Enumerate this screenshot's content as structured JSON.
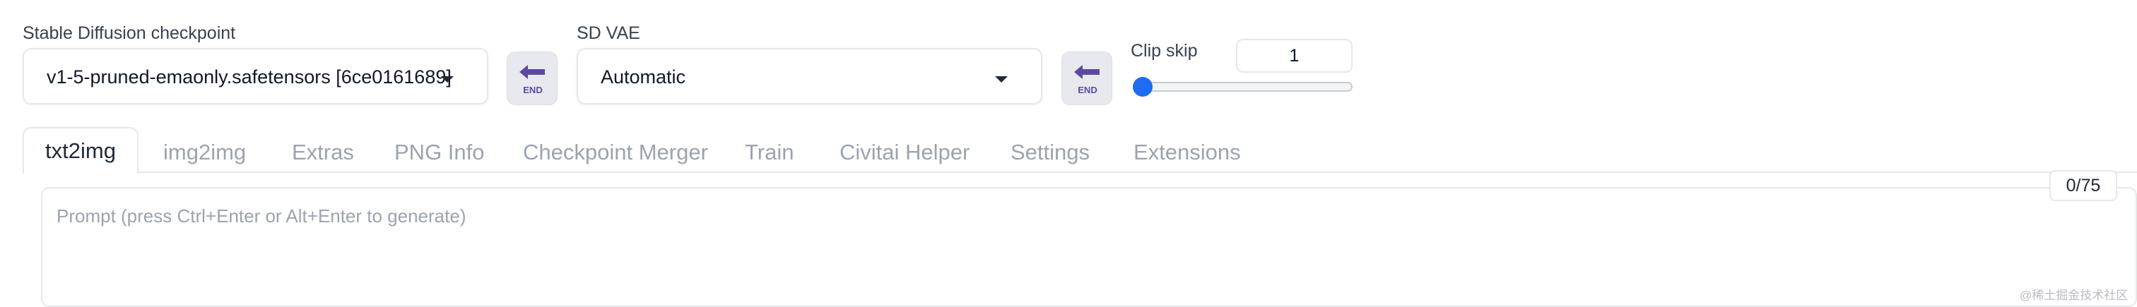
{
  "checkpoint": {
    "label": "Stable Diffusion checkpoint",
    "value": "v1-5-pruned-emaonly.safetensors [6ce0161689]"
  },
  "vae": {
    "label": "SD VAE",
    "value": "Automatic"
  },
  "refresh_icon": "refresh-end-icon",
  "clip_skip": {
    "label": "Clip skip",
    "value": "1",
    "slider_level": 0
  },
  "tabs": [
    {
      "label": "txt2img",
      "active": true
    },
    {
      "label": "img2img"
    },
    {
      "label": "Extras"
    },
    {
      "label": "PNG Info"
    },
    {
      "label": "Checkpoint Merger"
    },
    {
      "label": "Train"
    },
    {
      "label": "Civitai Helper"
    },
    {
      "label": "Settings"
    },
    {
      "label": "Extensions"
    }
  ],
  "prompt": {
    "placeholder": "Prompt (press Ctrl+Enter or Alt+Enter to generate)",
    "token_counter": "0/75"
  },
  "watermark": "@稀土掘金技术社区",
  "colors": {
    "accent": "#1d6cf2",
    "icon_purple": "#5b4a9e"
  }
}
